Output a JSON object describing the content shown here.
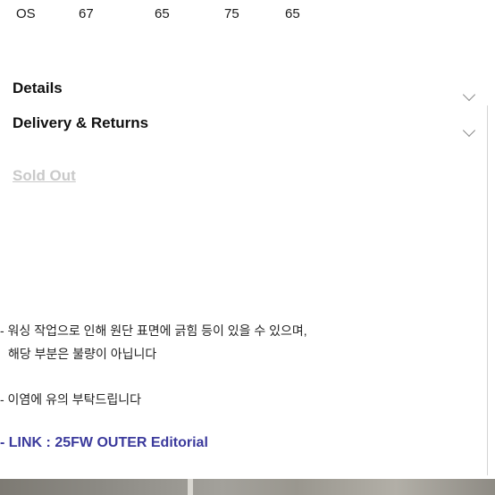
{
  "size_table": {
    "row": [
      "OS",
      "67",
      "65",
      "75",
      "65"
    ]
  },
  "accordions": {
    "details_label": "Details",
    "delivery_label": "Delivery & Returns"
  },
  "purchase": {
    "status_label": "Sold Out"
  },
  "description": {
    "line1": "- 워싱 작업으로 인해 원단 표면에 긁힘 등이 있을 수 있으며,",
    "line2": "해당 부분은 불량이 아닙니다",
    "line3": "- 이염에 유의 부탁드립니다",
    "link_text": "- LINK : 25FW OUTER Editorial"
  },
  "colors": {
    "link": "#3b3a9c",
    "sold_out": "#c9c9c9",
    "chevron": "#8a8a8a"
  },
  "icons": {
    "accordion_toggle": "chevron-down-icon"
  }
}
